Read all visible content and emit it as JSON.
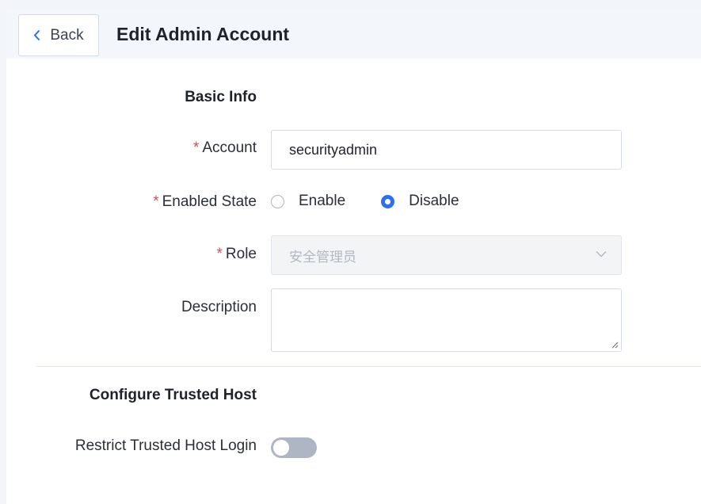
{
  "header": {
    "back_label": "Back",
    "title": "Edit Admin Account"
  },
  "basic_info": {
    "section_title": "Basic Info",
    "account": {
      "label": "Account",
      "required_mark": "*",
      "value": "securityadmin"
    },
    "enabled_state": {
      "label": "Enabled State",
      "required_mark": "*",
      "options": [
        {
          "label": "Enable",
          "selected": false
        },
        {
          "label": "Disable",
          "selected": true
        }
      ]
    },
    "role": {
      "label": "Role",
      "required_mark": "*",
      "value": "安全管理员",
      "disabled": true
    },
    "description": {
      "label": "Description",
      "value": ""
    }
  },
  "trusted_host": {
    "section_title": "Configure Trusted Host",
    "restrict_label": "Restrict Trusted Host Login",
    "restrict_enabled": false
  },
  "colors": {
    "accent": "#2f6fed",
    "required": "#e5484d",
    "header_bg": "#f3f6fb",
    "toggle_off": "#aeb6c3"
  },
  "icons": {
    "back": "chevron-left-icon",
    "role_dropdown": "chevron-down-icon",
    "resize": "resize-grip-icon"
  }
}
